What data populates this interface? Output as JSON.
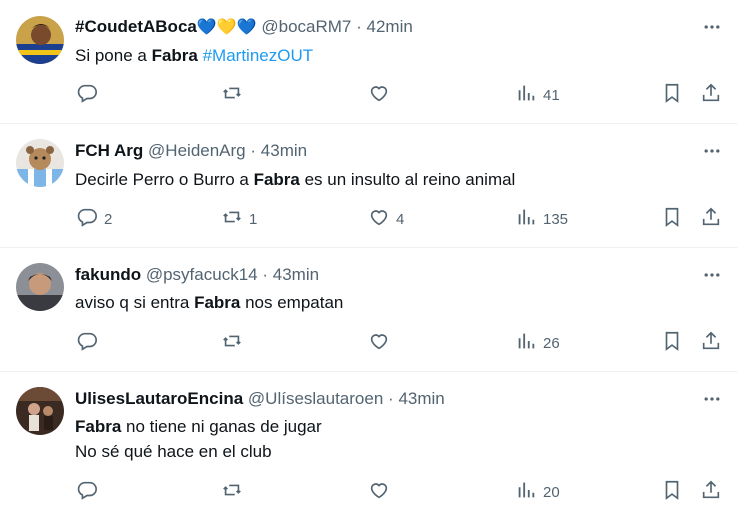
{
  "tweets": [
    {
      "name": "#CoudetABoca",
      "emoji": "💙💛💙",
      "handle": "@bocaRM7",
      "time": "42min",
      "lines": [
        {
          "pre": "Si pone a ",
          "bold": "Fabra",
          "post": " ",
          "tag": "#MartinezOUT"
        }
      ],
      "replies": "",
      "reposts": "",
      "likes": "",
      "views": "41"
    },
    {
      "name": "FCH Arg",
      "emoji": "",
      "handle": "@HeidenArg",
      "time": "43min",
      "lines": [
        {
          "pre": "Decirle Perro o Burro a ",
          "bold": "Fabra",
          "post": " es un insulto al reino animal",
          "tag": ""
        }
      ],
      "replies": "2",
      "reposts": "1",
      "likes": "4",
      "views": "135"
    },
    {
      "name": "fakundo",
      "emoji": "",
      "handle": "@psyfacuck14",
      "time": "43min",
      "lines": [
        {
          "pre": "aviso q si entra ",
          "bold": "Fabra",
          "post": " nos empatan",
          "tag": ""
        }
      ],
      "replies": "",
      "reposts": "",
      "likes": "",
      "views": "26"
    },
    {
      "name": "UlisesLautaroEncina",
      "emoji": "",
      "handle": "@Ulíseslautaroen",
      "time": "43min",
      "lines": [
        {
          "pre": "",
          "bold": "Fabra",
          "post": " no tiene ni ganas de jugar",
          "tag": ""
        },
        {
          "pre": "No sé qué hace en el club",
          "bold": "",
          "post": "",
          "tag": ""
        }
      ],
      "replies": "",
      "reposts": "",
      "likes": "",
      "views": "20"
    }
  ],
  "separator": "·",
  "colors": {
    "text": "#0f1419",
    "secondary": "#536471",
    "link": "#1d9bf0",
    "border": "#eff3f4"
  },
  "icons": [
    "more-icon",
    "reply-icon",
    "repost-icon",
    "like-icon",
    "views-icon",
    "bookmark-icon",
    "share-icon"
  ]
}
